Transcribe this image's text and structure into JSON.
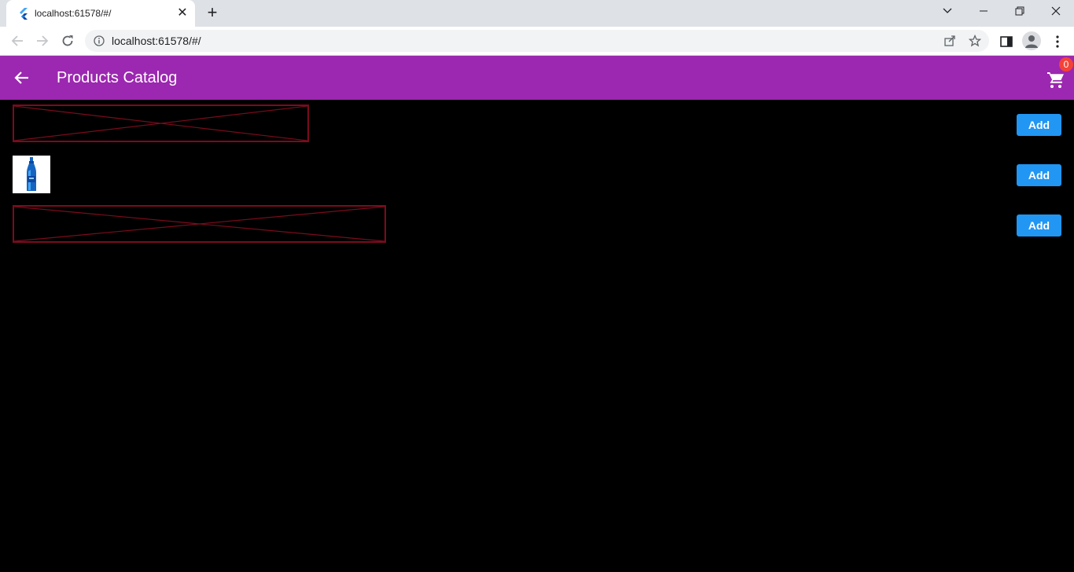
{
  "browser": {
    "tab_title": "localhost:61578/#/",
    "tab_close": "✕",
    "new_tab": "+",
    "url": "localhost:61578/#/"
  },
  "appbar": {
    "title": "Products Catalog",
    "cart_count": "0",
    "color": "#9c27b0"
  },
  "products": [
    {
      "image": "broken-image",
      "add_label": "Add"
    },
    {
      "image": "blue-bottle",
      "add_label": "Add"
    },
    {
      "image": "broken-image",
      "add_label": "Add"
    }
  ],
  "colors": {
    "add_button": "#2196f3",
    "badge": "#f44336",
    "broken_image_border": "#7a0c1d"
  }
}
